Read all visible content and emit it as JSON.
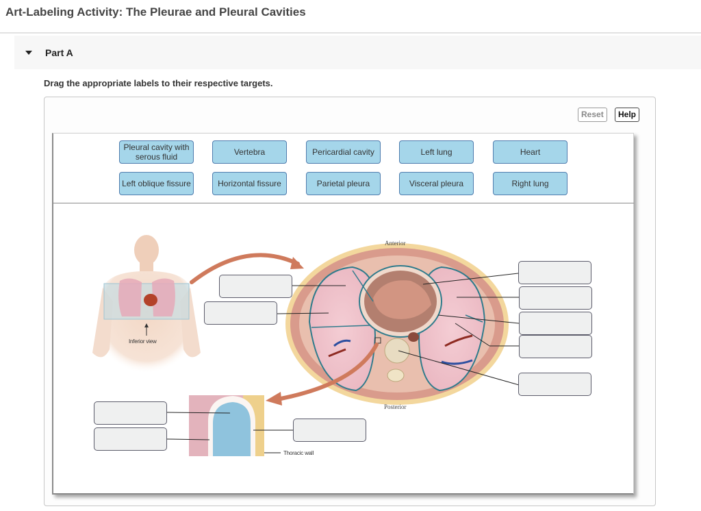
{
  "page": {
    "title": "Art-Labeling Activity: The Pleurae and Pleural Cavities"
  },
  "part": {
    "label": "Part A",
    "instructions": "Drag the appropriate labels to their respective targets."
  },
  "toolbar": {
    "reset_label": "Reset",
    "help_label": "Help"
  },
  "label_bank": [
    {
      "text": "Pleural cavity with serous fluid"
    },
    {
      "text": "Vertebra"
    },
    {
      "text": "Pericardial cavity"
    },
    {
      "text": "Left lung"
    },
    {
      "text": "Heart"
    },
    {
      "text": "Left oblique fissure"
    },
    {
      "text": "Horizontal fissure"
    },
    {
      "text": "Parietal pleura"
    },
    {
      "text": "Visceral pleura"
    },
    {
      "text": "Right lung"
    }
  ],
  "figure": {
    "body_view_caption": "Inferior view",
    "anterior_caption": "Anterior",
    "posterior_caption": "Posterior",
    "thoracic_wall_caption": "Thoracic wall"
  },
  "drop_targets": [
    {
      "id": "target-1",
      "value": ""
    },
    {
      "id": "target-2",
      "value": ""
    },
    {
      "id": "target-3",
      "value": ""
    },
    {
      "id": "target-4",
      "value": ""
    },
    {
      "id": "target-5",
      "value": ""
    },
    {
      "id": "target-6",
      "value": ""
    },
    {
      "id": "target-7",
      "value": ""
    },
    {
      "id": "target-8",
      "value": ""
    },
    {
      "id": "target-9",
      "value": ""
    },
    {
      "id": "target-10",
      "value": ""
    }
  ],
  "colors": {
    "label_fill": "#a5d6ea",
    "label_border": "#4f7cae",
    "target_fill": "#eff0f0",
    "arrow": "#cf7a5c"
  }
}
